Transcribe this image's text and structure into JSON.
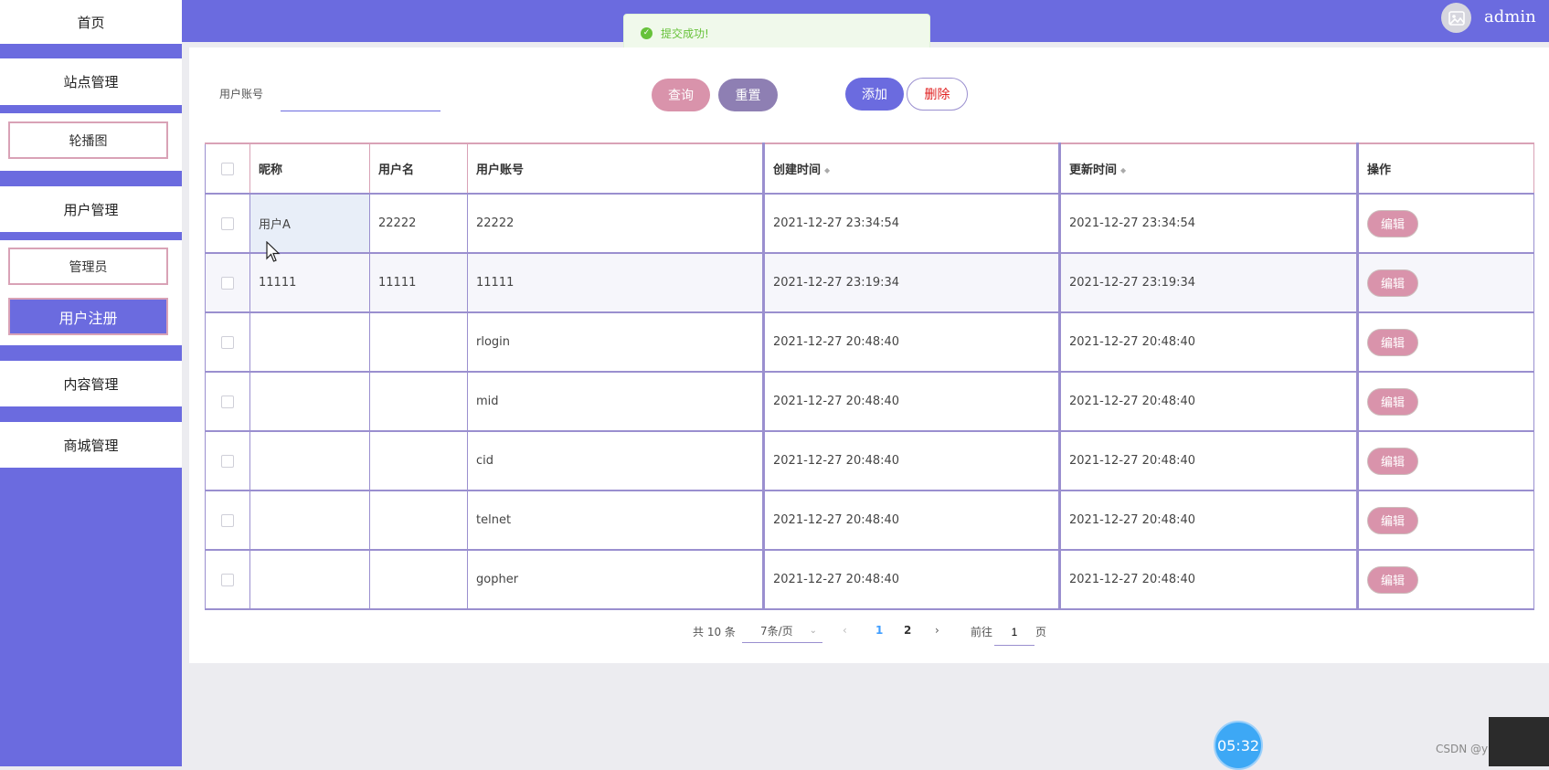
{
  "sidebar": {
    "items": [
      {
        "label": "首页"
      },
      {
        "label": "站点管理"
      },
      {
        "label": "轮播图"
      },
      {
        "label": "用户管理"
      },
      {
        "label": "管理员"
      },
      {
        "label": "用户注册"
      },
      {
        "label": "内容管理"
      },
      {
        "label": "商城管理"
      }
    ]
  },
  "header": {
    "username": "admin",
    "toast": "提交成功!"
  },
  "search": {
    "label": "用户账号",
    "value": "",
    "query_label": "查询",
    "reset_label": "重置",
    "add_label": "添加",
    "delete_label": "删除"
  },
  "table": {
    "columns": [
      "昵称",
      "用户名",
      "用户账号",
      "创建时间",
      "更新时间",
      "操作"
    ],
    "edit_label": "编辑",
    "rows": [
      {
        "nickname": "用户A",
        "username": "22222",
        "account": "22222",
        "created": "2021-12-27 23:34:54",
        "updated": "2021-12-27 23:34:54"
      },
      {
        "nickname": "11111",
        "username": "11111",
        "account": "11111",
        "created": "2021-12-27 23:19:34",
        "updated": "2021-12-27 23:19:34"
      },
      {
        "nickname": "",
        "username": "",
        "account": "rlogin",
        "created": "2021-12-27 20:48:40",
        "updated": "2021-12-27 20:48:40"
      },
      {
        "nickname": "",
        "username": "",
        "account": "mid",
        "created": "2021-12-27 20:48:40",
        "updated": "2021-12-27 20:48:40"
      },
      {
        "nickname": "",
        "username": "",
        "account": "cid",
        "created": "2021-12-27 20:48:40",
        "updated": "2021-12-27 20:48:40"
      },
      {
        "nickname": "",
        "username": "",
        "account": "telnet",
        "created": "2021-12-27 20:48:40",
        "updated": "2021-12-27 20:48:40"
      },
      {
        "nickname": "",
        "username": "",
        "account": "gopher",
        "created": "2021-12-27 20:48:40",
        "updated": "2021-12-27 20:48:40"
      }
    ]
  },
  "pagination": {
    "total": "共 10 条",
    "page_size": "7条/页",
    "pages": [
      "1",
      "2"
    ],
    "goto_label": "前往",
    "goto_value": "1",
    "page_suffix": "页"
  },
  "overlay": {
    "timer": "05:32",
    "watermark": "CSDN @yuyuxun1"
  },
  "colors": {
    "primary": "#6b6bdf",
    "pink": "#d993ab",
    "mauve": "#8e7fb3",
    "success": "#67c23a"
  }
}
